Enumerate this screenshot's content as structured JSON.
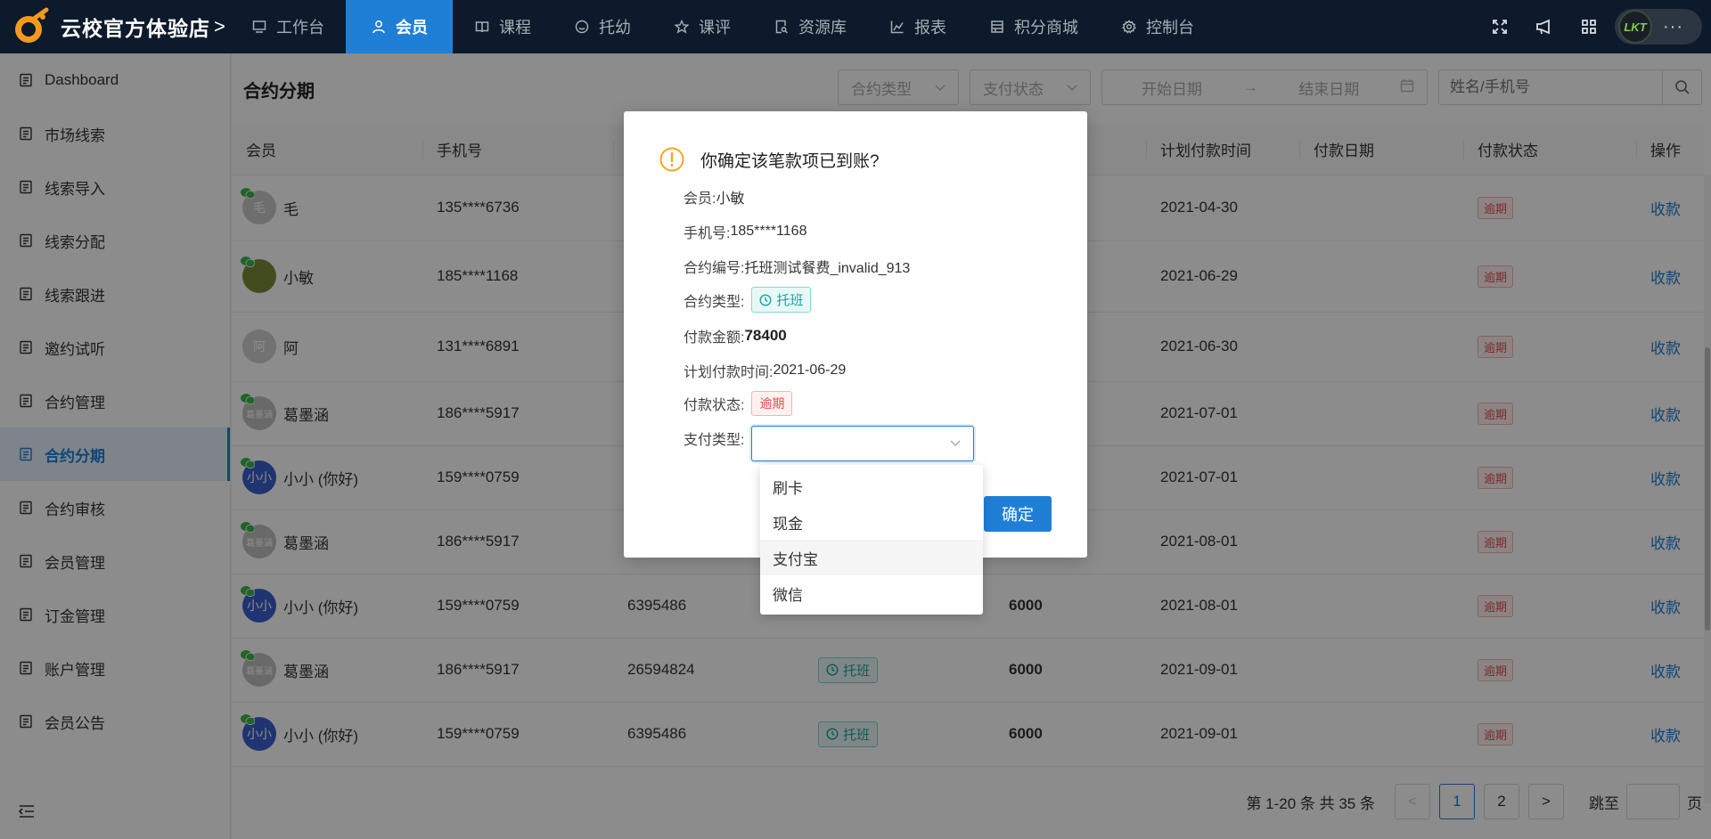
{
  "brand": {
    "name": "云校官方体验店",
    "caret": ">"
  },
  "nav": [
    {
      "label": "工作台",
      "icon": "monitor-icon",
      "active": false
    },
    {
      "label": "会员",
      "icon": "user-icon",
      "active": true
    },
    {
      "label": "课程",
      "icon": "book-icon",
      "active": false
    },
    {
      "label": "托幼",
      "icon": "smile-icon",
      "active": false
    },
    {
      "label": "课评",
      "icon": "star-icon",
      "active": false
    },
    {
      "label": "资源库",
      "icon": "file-search-icon",
      "active": false
    },
    {
      "label": "报表",
      "icon": "chart-icon",
      "active": false
    },
    {
      "label": "积分商城",
      "icon": "shop-icon",
      "active": false
    },
    {
      "label": "控制台",
      "icon": "gear-icon",
      "active": false
    }
  ],
  "user": {
    "avatar_text": "LKT",
    "more": "···"
  },
  "sidebar": {
    "items": [
      {
        "label": "Dashboard",
        "icon": "dashboard-icon"
      },
      {
        "label": "市场线索",
        "icon": "leads-icon"
      },
      {
        "label": "线索导入",
        "icon": "import-icon"
      },
      {
        "label": "线索分配",
        "icon": "distribute-icon"
      },
      {
        "label": "线索跟进",
        "icon": "phone-icon"
      },
      {
        "label": "邀约试听",
        "icon": "invite-icon"
      },
      {
        "label": "合约管理",
        "icon": "contract-icon"
      },
      {
        "label": "合约分期",
        "icon": "installment-icon",
        "active": true
      },
      {
        "label": "合约审核",
        "icon": "audit-icon"
      },
      {
        "label": "会员管理",
        "icon": "members-icon"
      },
      {
        "label": "订金管理",
        "icon": "deposit-icon"
      },
      {
        "label": "账户管理",
        "icon": "account-icon"
      },
      {
        "label": "会员公告",
        "icon": "announce-icon"
      }
    ]
  },
  "page": {
    "title": "合约分期"
  },
  "filters": {
    "contract_type": "合约类型",
    "pay_status": "支付状态",
    "start_date": "开始日期",
    "arrow": "→",
    "end_date": "结束日期",
    "search_placeholder": "姓名/手机号"
  },
  "table": {
    "columns": [
      "会员",
      "手机号",
      "",
      "",
      "",
      "计划付款时间",
      "付款日期",
      "付款状态",
      "操作"
    ],
    "rows": [
      {
        "name": "毛",
        "avatar": "毛",
        "avatar_color": "#c8c8c8",
        "phone": "135****6736",
        "contract_no": "",
        "type": "",
        "amount": "",
        "plan_date": "2021-04-30",
        "pay_date": "",
        "status": "逾期",
        "action": "收款"
      },
      {
        "name": "小敏",
        "avatar": "",
        "avatar_color": "#7a8a3a",
        "phone": "185****1168",
        "contract_no": "",
        "type": "",
        "amount": "",
        "plan_date": "2021-06-29",
        "pay_date": "",
        "status": "逾期",
        "action": "收款"
      },
      {
        "name": "阿",
        "avatar": "阿",
        "avatar_color": "#d0d0d0",
        "phone": "131****6891",
        "contract_no": "",
        "type": "",
        "amount": "",
        "plan_date": "2021-06-30",
        "pay_date": "",
        "status": "逾期",
        "action": "收款"
      },
      {
        "name": "葛墨涵",
        "avatar": "葛墨涵",
        "avatar_color": "#c0c0c0",
        "phone": "186****5917",
        "contract_no": "",
        "type": "",
        "amount": "",
        "plan_date": "2021-07-01",
        "pay_date": "",
        "status": "逾期",
        "action": "收款"
      },
      {
        "name": "小小 (你好)",
        "avatar": "小小",
        "avatar_color": "#3a5fcd",
        "phone": "159****0759",
        "contract_no": "",
        "type": "",
        "amount": "",
        "plan_date": "2021-07-01",
        "pay_date": "",
        "status": "逾期",
        "action": "收款"
      },
      {
        "name": "葛墨涵",
        "avatar": "葛墨涵",
        "avatar_color": "#c0c0c0",
        "phone": "186****5917",
        "contract_no": "",
        "type": "",
        "amount": "",
        "plan_date": "2021-08-01",
        "pay_date": "",
        "status": "逾期",
        "action": "收款"
      },
      {
        "name": "小小 (你好)",
        "avatar": "小小",
        "avatar_color": "#3a5fcd",
        "phone": "159****0759",
        "contract_no": "6395486",
        "type": "",
        "amount": "6000",
        "plan_date": "2021-08-01",
        "pay_date": "",
        "status": "逾期",
        "action": "收款"
      },
      {
        "name": "葛墨涵",
        "avatar": "葛墨涵",
        "avatar_color": "#c0c0c0",
        "phone": "186****5917",
        "contract_no": "26594824",
        "type": "托班",
        "amount": "6000",
        "plan_date": "2021-09-01",
        "pay_date": "",
        "status": "逾期",
        "action": "收款"
      },
      {
        "name": "小小 (你好)",
        "avatar": "小小",
        "avatar_color": "#3a5fcd",
        "phone": "159****0759",
        "contract_no": "6395486",
        "type": "托班",
        "amount": "6000",
        "plan_date": "2021-09-01",
        "pay_date": "",
        "status": "逾期",
        "action": "收款"
      }
    ]
  },
  "pager": {
    "total": "第 1-20 条 共 35 条",
    "prev": "<",
    "next": ">",
    "pages": [
      "1",
      "2"
    ],
    "jump_label": "跳至",
    "page_unit": "页"
  },
  "modal": {
    "title": "你确定该笔款项已到账?",
    "member_label": "会员:",
    "member": "小敏",
    "phone_label": "手机号:",
    "phone": "185****1168",
    "contract_no_label": "合约编号:",
    "contract_no": "托班测试餐费_invalid_913",
    "type_label": "合约类型:",
    "type": "托班",
    "amount_label": "付款金额:",
    "amount": "78400",
    "plan_label": "计划付款时间:",
    "plan_date": "2021-06-29",
    "status_label": "付款状态:",
    "status": "逾期",
    "pay_type_label": "支付类型:",
    "ok": "确定"
  },
  "dropdown": {
    "options": [
      "刷卡",
      "现金",
      "支付宝",
      "微信"
    ],
    "hover_index": 2
  },
  "colors": {
    "primary": "#1f7fd6",
    "nav_bg": "#0c1a2b",
    "overdue": "#e34d4d",
    "tuoban": "#13a89e"
  }
}
